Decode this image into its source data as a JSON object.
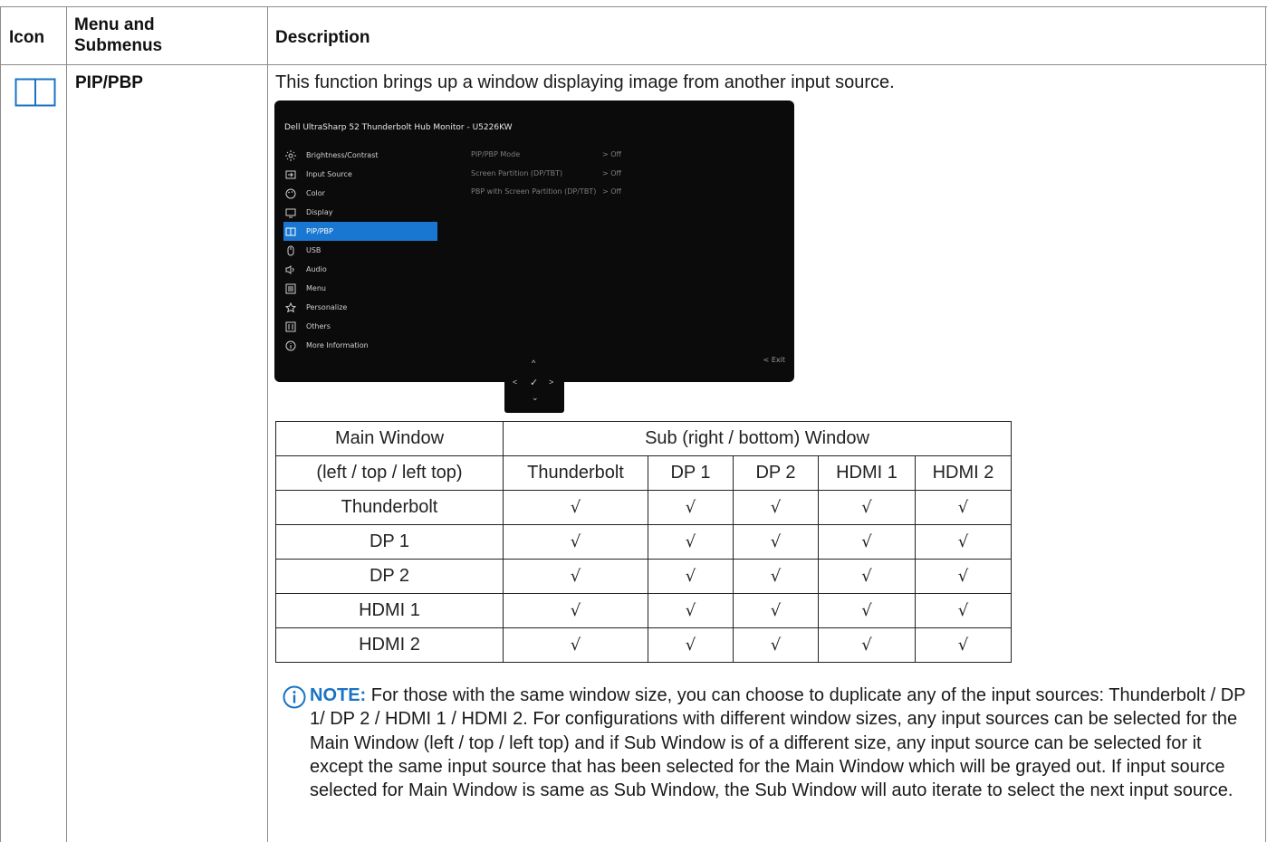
{
  "header": {
    "icon": "Icon",
    "menu_line1": "Menu and",
    "menu_line2": "Submenus",
    "description": "Description"
  },
  "row": {
    "menu_name": "PIP/PBP",
    "icon_name": "pip-pbp-icon",
    "description": "This function brings up a window displaying image from another input source."
  },
  "osd": {
    "title": "Dell UltraSharp 52 Thunderbolt Hub Monitor - U5226KW",
    "menu_items": [
      {
        "label": "Brightness/Contrast",
        "icon": "brightness-icon",
        "active": false
      },
      {
        "label": "Input Source",
        "icon": "input-source-icon",
        "active": false
      },
      {
        "label": "Color",
        "icon": "color-icon",
        "active": false
      },
      {
        "label": "Display",
        "icon": "display-icon",
        "active": false
      },
      {
        "label": "PIP/PBP",
        "icon": "pip-pbp-icon",
        "active": true
      },
      {
        "label": "USB",
        "icon": "usb-icon",
        "active": false
      },
      {
        "label": "Audio",
        "icon": "audio-icon",
        "active": false
      },
      {
        "label": "Menu",
        "icon": "menu-icon",
        "active": false
      },
      {
        "label": "Personalize",
        "icon": "star-icon",
        "active": false
      },
      {
        "label": "Others",
        "icon": "others-icon",
        "active": false
      },
      {
        "label": "More Information",
        "icon": "info-icon",
        "active": false
      }
    ],
    "submenu": [
      {
        "label": "PIP/PBP Mode",
        "value": ">  Off"
      },
      {
        "label": "Screen Partition (DP/TBT)",
        "value": ">  Off"
      },
      {
        "label": "PBP with Screen Partition (DP/TBT)",
        "value": ">  Off"
      }
    ],
    "exit_label": "<  Exit",
    "nav": {
      "up": "^",
      "left": "<",
      "ok": "✓",
      "right": ">",
      "down": "⌄"
    },
    "accent": "#1977d2"
  },
  "table": {
    "main_header_line1": "Main Window",
    "main_header_line2": "(left / top / left top)",
    "sub_header": "Sub (right / bottom) Window",
    "columns": [
      "Thunderbolt",
      "DP 1",
      "DP 2",
      "HDMI 1",
      "HDMI 2"
    ],
    "rows": [
      {
        "label": "Thunderbolt",
        "cells": [
          "√",
          "√",
          "√",
          "√",
          "√"
        ]
      },
      {
        "label": "DP 1",
        "cells": [
          "√",
          "√",
          "√",
          "√",
          "√"
        ]
      },
      {
        "label": "DP 2",
        "cells": [
          "√",
          "√",
          "√",
          "√",
          "√"
        ]
      },
      {
        "label": "HDMI 1",
        "cells": [
          "√",
          "√",
          "√",
          "√",
          "√"
        ]
      },
      {
        "label": "HDMI 2",
        "cells": [
          "√",
          "√",
          "√",
          "√",
          "√"
        ]
      }
    ]
  },
  "note": {
    "label": "NOTE:",
    "text": " For those with the same window size, you can choose to duplicate any of the input sources: Thunderbolt / DP 1/ DP 2 / HDMI 1 / HDMI 2. For configurations with different window sizes, any input sources can be selected for the Main Window (left / top / left top) and if Sub Window is of a different size, any input source can be selected for it except the same input source that has been selected for the Main Window which will be grayed out. If input source selected for Main Window is same as Sub Window, the Sub Window will auto iterate to select the next input source.",
    "icon": "info-circle-icon",
    "accent": "#1a73c4"
  }
}
